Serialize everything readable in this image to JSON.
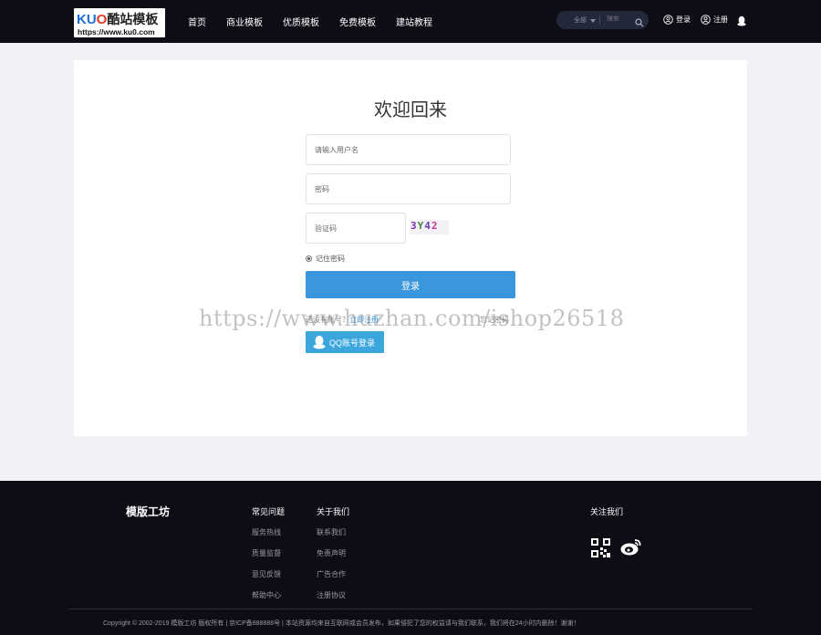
{
  "header": {
    "logo": {
      "main_latin": "KU",
      "main_o": "O",
      "main_cn": "酷站模板",
      "url": "https://www.ku0.com"
    },
    "nav": [
      "首页",
      "商业模板",
      "优质模板",
      "免费模板",
      "建站教程"
    ],
    "search": {
      "category": "全部",
      "placeholder": "搜索"
    },
    "login_label": "登录",
    "register_label": "注册"
  },
  "form": {
    "title": "欢迎回来",
    "username_placeholder": "请输入用户名",
    "password_placeholder": "密码",
    "captcha_placeholder": "验证码",
    "captcha_chars": [
      "3",
      "Y",
      "4",
      "2"
    ],
    "remember_label": "记住密码",
    "login_button": "登录",
    "register_prompt": "还没有账号？",
    "register_link": "立即注册",
    "forgot_link": "忘记密码",
    "qq_login": "QQ账号登录"
  },
  "watermark": "https://www.huzhan.com/ishop26518",
  "footer": {
    "brand": "模版工坊",
    "columns": [
      {
        "title": "常见问题",
        "links": [
          "服务热线",
          "质量监督",
          "意见反馈",
          "帮助中心"
        ]
      },
      {
        "title": "关于我们",
        "links": [
          "联系我们",
          "免责声明",
          "广告合作",
          "注册协议"
        ]
      }
    ],
    "follow_title": "关注我们",
    "copyright": "Copyright © 2002-2019 模版工坊 版权所有 | 京ICP备888888号 | 本站资源均来自互联网或会员发布，如果侵犯了您的权益请与我们联系，我们将在24小时内删除！谢谢！"
  },
  "colors": {
    "header_bg": "#0d0d16",
    "accent": "#3a97de",
    "qq_button": "#3aa6dc",
    "page_bg": "#f1f2f5"
  }
}
